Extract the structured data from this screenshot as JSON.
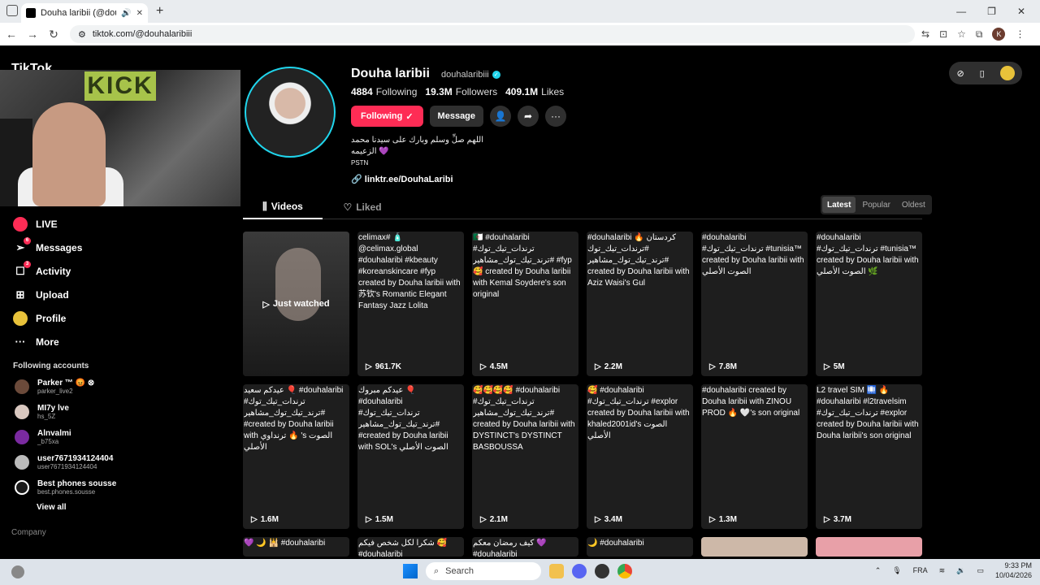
{
  "browser": {
    "tab_title": "Douha laribii (@douhalaribi",
    "url": "tiktok.com/@douhalaribiii",
    "profile_initial": "K"
  },
  "tiktok_logo": "TikTok",
  "webcam_sign": "KICK",
  "profile": {
    "name": "Douha laribii",
    "username": "douhalaribiii",
    "following_count": "4884",
    "following_label": "Following",
    "followers_count": "19.3M",
    "followers_label": "Followers",
    "likes_count": "409.1M",
    "likes_label": "Likes",
    "following_btn": "Following",
    "message_btn": "Message",
    "bio_line1": "اللهم صلِّ وسلم وبارك على سيدنا محمد",
    "bio_line2": "الزعيمه 💜",
    "bio_line3": "PSTN",
    "link": "linktr.ee/DouhaLaribi"
  },
  "sidenav": {
    "items": [
      {
        "label": "LIVE"
      },
      {
        "label": "Messages",
        "badge": "6"
      },
      {
        "label": "Activity",
        "badge": "3"
      },
      {
        "label": "Upload"
      },
      {
        "label": "Profile"
      },
      {
        "label": "More"
      }
    ],
    "following_title": "Following accounts",
    "accounts": [
      {
        "name": "Parker ™ 😡 ⊗",
        "handle": "parker_live2",
        "color": "#6b4a3a"
      },
      {
        "name": "MI7y lve",
        "handle": "hs_5Z",
        "color": "#d9c8c0"
      },
      {
        "name": "Alnvalmi",
        "handle": "_b75xa",
        "color": "#7a2aa0"
      },
      {
        "name": "user7671934124404",
        "handle": "user7671934124404",
        "color": "#bbbbbb"
      },
      {
        "name": "Best phones sousse",
        "handle": "best.phones.sousse",
        "color": "#1a1a1a"
      }
    ],
    "view_all": "View all",
    "company": "Company"
  },
  "tabs": {
    "videos": "Videos",
    "liked": "Liked",
    "sort": [
      "Latest",
      "Popular",
      "Oldest"
    ]
  },
  "videos": [
    {
      "caption": "",
      "views": "",
      "just_watched": "Just watched"
    },
    {
      "caption": "celimax# 🧴 @celimax.global #douhalaribi #kbeauty #koreanskincare #fyp created by Douha laribii with 苏钦's Romantic Elegant Fantasy Jazz Lolita",
      "views": "961.7K"
    },
    {
      "caption": "🇩🇿 #douhalaribi #ترندات_تيك_توك #ترند_تيك_توك_مشاهير #fyp 🥰 created by Douha laribii with Kemal Soydere's son original",
      "views": "4.5M"
    },
    {
      "caption": "#douhalaribi 🔥 كردستان #ترندات_تيك_توك #ترند_تيك_توك_مشاهير created by Douha laribii with Aziz Waisi's Gul",
      "views": "2.2M"
    },
    {
      "caption": "#douhalaribi #ترندات_تيك_توك #tunisia™ created by Douha laribii with الصوت الأصلي",
      "views": "7.8M"
    },
    {
      "caption": "#douhalaribi #ترندات_تيك_توك #tunisia™ created by Douha laribii with الصوت الأصلي 🌿",
      "views": "5M"
    },
    {
      "caption": "عيدكم سعيد 🎈 #douhalaribi #ترندات_تيك_توك #ترند_تيك_توك_مشاهير #created by Douha laribii with ترنداوي 🔥 's الصوت الأصلي",
      "views": "1.6M"
    },
    {
      "caption": "عيدكم مبروك 🎈 #douhalaribi #ترندات_تيك_توك #ترند_تيك_توك_مشاهير #created by Douha laribii with SOL's الصوت الأصلي",
      "views": "1.5M"
    },
    {
      "caption": "🥰🥰🥰🥰 #douhalaribi #ترندات_تيك_توك #ترند_تيك_توك_مشاهير created by Douha laribii with DYSTINCT's DYSTINCT BASBOUSSA",
      "views": "2.1M"
    },
    {
      "caption": "🥰 #douhalaribi #ترندات_تيك_توك #explor created by Douha laribii with khaled2001id's الصوت الأصلي",
      "views": "3.4M"
    },
    {
      "caption": "#douhalaribi created by Douha laribii with ZINOU PROD 🔥 🤍's son original",
      "views": "1.3M"
    },
    {
      "caption": "L2 travel SIM 🛄 🔥 #douhalaribi #l2travelsim #ترندات_تيك_توك #explor created by Douha laribii with Douha laribii's son original",
      "views": "3.7M"
    },
    {
      "caption": "💜 🌙 🕌 #douhalaribi",
      "views": ""
    },
    {
      "caption": "شكرا لكل شخص فيكم 🥰 #douhalaribi",
      "views": ""
    },
    {
      "caption": "كيف رمضان معكم 💜 #douhalaribi",
      "views": ""
    },
    {
      "caption": "🌙 #douhalaribi",
      "views": ""
    },
    {
      "caption": "",
      "views": ""
    },
    {
      "caption": "",
      "views": ""
    }
  ],
  "taskbar": {
    "search": "Search",
    "lang": "FRA",
    "time": "9:33 PM",
    "date": "10/04/2026"
  }
}
